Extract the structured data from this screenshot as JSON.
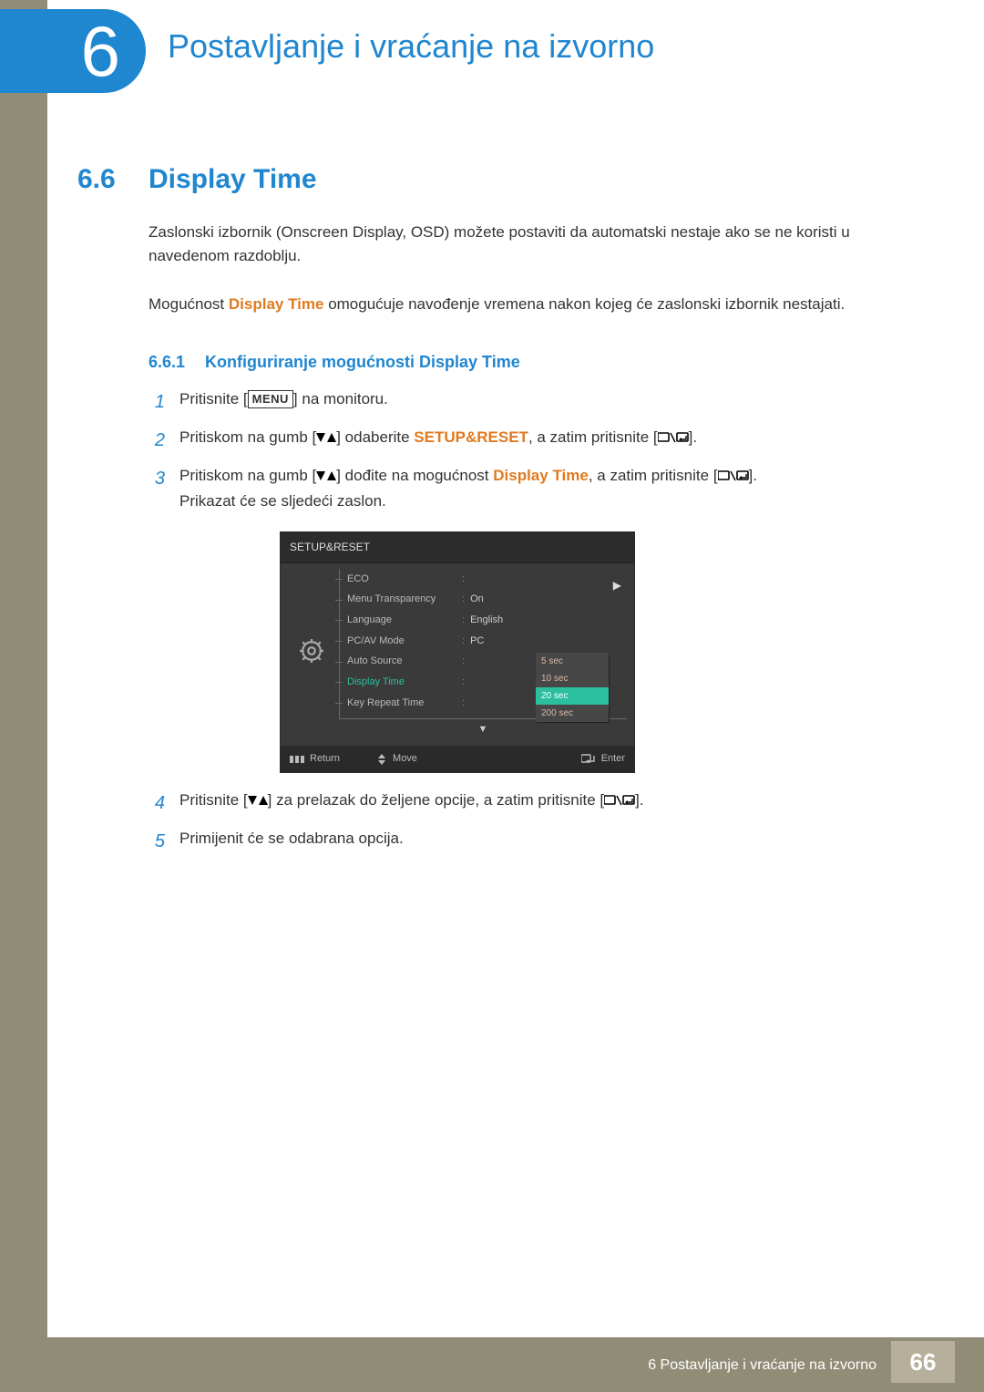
{
  "chapter": {
    "number": "6",
    "title": "Postavljanje i vraćanje na izvorno"
  },
  "section": {
    "number": "6.6",
    "title": "Display Time",
    "para1": "Zaslonski izbornik (Onscreen Display, OSD) možete postaviti da automatski nestaje ako se ne koristi u navedenom razdoblju.",
    "para2_pre": "Mogućnost ",
    "para2_em": "Display Time",
    "para2_post": " omogućuje navođenje vremena nakon kojeg će zaslonski izbornik nestajati."
  },
  "subsection": {
    "number": "6.6.1",
    "title": "Konfiguriranje mogućnosti Display Time"
  },
  "steps": {
    "s1_n": "1",
    "s1_pre": "Pritisnite [",
    "s1_menu": "MENU",
    "s1_post": "] na monitoru.",
    "s2_n": "2",
    "s2_pre": "Pritiskom na gumb [",
    "s2_mid": "] odaberite ",
    "s2_em": "SETUP&RESET",
    "s2_post_a": ", a zatim pritisnite [",
    "s2_post_b": "].",
    "s3_n": "3",
    "s3_pre": "Pritiskom na gumb [",
    "s3_mid": "] dođite na mogućnost ",
    "s3_em": "Display Time",
    "s3_post_a": ", a zatim pritisnite [",
    "s3_post_b": "].",
    "s3_line2": "Prikazat će se sljedeći zaslon.",
    "s4_n": "4",
    "s4_pre": "Pritisnite [",
    "s4_mid": "] za prelazak do željene opcije, a zatim pritisnite [",
    "s4_post": "].",
    "s5_n": "5",
    "s5_text": "Primijenit će se odabrana opcija."
  },
  "osd": {
    "title": "SETUP&RESET",
    "rows": [
      {
        "label": "ECO",
        "value": ""
      },
      {
        "label": "Menu Transparency",
        "value": "On"
      },
      {
        "label": "Language",
        "value": "English"
      },
      {
        "label": "PC/AV Mode",
        "value": "PC"
      },
      {
        "label": "Auto Source",
        "value": ""
      },
      {
        "label": "Display Time",
        "value": ""
      },
      {
        "label": "Key Repeat Time",
        "value": ""
      }
    ],
    "popup": [
      "5 sec",
      "10 sec",
      "20 sec",
      "200 sec"
    ],
    "popup_selected_index": 2,
    "footer": {
      "return": "Return",
      "move": "Move",
      "enter": "Enter"
    }
  },
  "footer": {
    "text": "6 Postavljanje i vraćanje na izvorno",
    "page": "66"
  }
}
